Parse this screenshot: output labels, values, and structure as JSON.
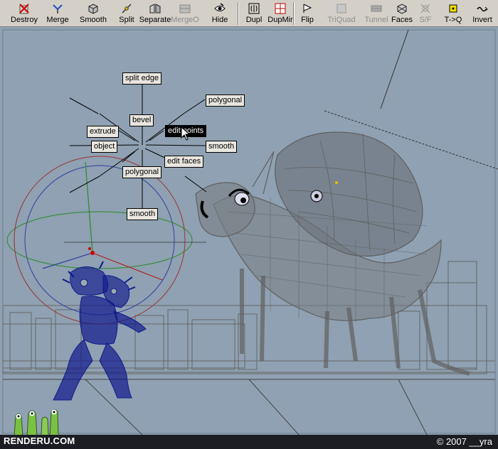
{
  "toolbar": {
    "tools": [
      {
        "label": "Destroy",
        "icon": "destroy-icon",
        "enabled": true
      },
      {
        "label": "Merge",
        "icon": "merge-icon",
        "enabled": true
      },
      {
        "label": "Smooth",
        "icon": "smooth-cube-icon",
        "enabled": true
      },
      {
        "label": "Split",
        "icon": "split-icon",
        "enabled": true
      },
      {
        "label": "Separate",
        "icon": "separate-icon",
        "enabled": true
      },
      {
        "label": "MergeO",
        "icon": "merge-objects-icon",
        "enabled": false
      },
      {
        "label": "Hide",
        "icon": "eye-icon",
        "enabled": true
      },
      {
        "label": "Dupl",
        "icon": "duplicate-icon",
        "enabled": true
      },
      {
        "label": "DupMir",
        "icon": "duplicate-mirror-icon",
        "enabled": true
      },
      {
        "label": "Flip",
        "icon": "flip-icon",
        "enabled": true
      },
      {
        "label": "TriQuad",
        "icon": "triquad-icon",
        "enabled": false
      },
      {
        "label": "Tunnel",
        "icon": "tunnel-icon",
        "enabled": false
      },
      {
        "label": "Faces",
        "icon": "faces-icon",
        "enabled": true
      },
      {
        "label": "S/F",
        "icon": "smooth-flat-icon",
        "enabled": false
      },
      {
        "label": "T->Q",
        "icon": "tri-to-quad-icon",
        "enabled": true
      },
      {
        "label": "Invert",
        "icon": "invert-icon",
        "enabled": true
      }
    ]
  },
  "marking_menu": {
    "items": {
      "split_edge": "split edge",
      "polygonal_top": "polygonal",
      "bevel": "bevel",
      "edit_points": "edit points",
      "extrude": "extrude",
      "object": "object",
      "smooth_right": "smooth",
      "edit_faces": "edit faces",
      "polygonal_bottom": "polygonal",
      "smooth_bottom": "smooth"
    },
    "active_item": "edit points"
  },
  "colors": {
    "viewport_bg": "#8fa1b2",
    "mesh_grey": "#5f5f5f",
    "mesh_blue": "#101a8c",
    "toolbar_bg": "#d4d0c8"
  },
  "footer": {
    "brand": "RENDERU.COM",
    "copyright": "© 2007 __yra"
  }
}
